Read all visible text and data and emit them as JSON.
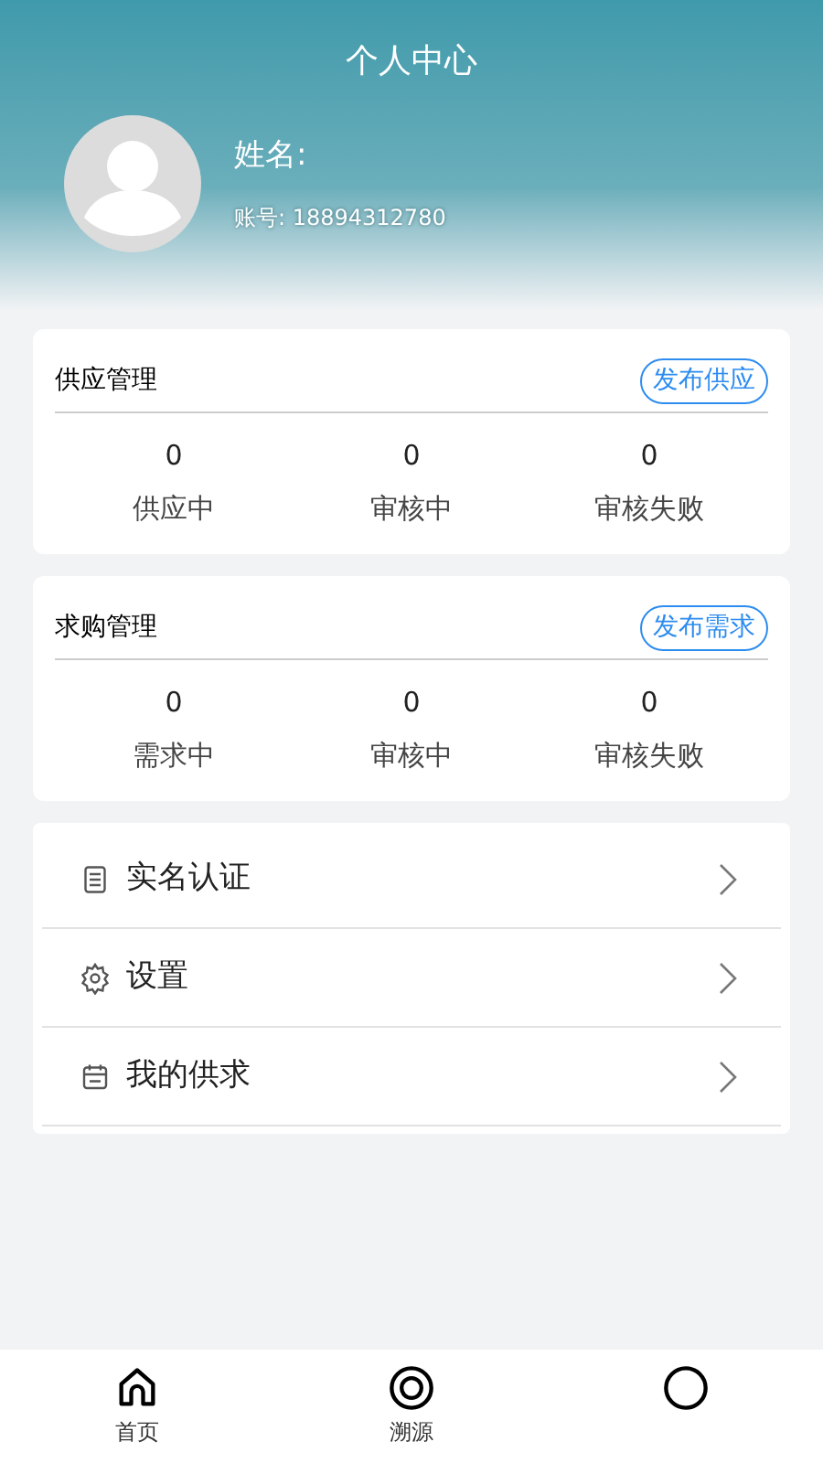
{
  "header": {
    "title": "个人中心",
    "name_label": "姓名:",
    "account": "账号: 18894312780"
  },
  "sections": [
    {
      "title": "供应管理",
      "action": "发布供应",
      "stats": [
        {
          "value": "0",
          "label": "供应中"
        },
        {
          "value": "0",
          "label": "审核中"
        },
        {
          "value": "0",
          "label": "审核失败"
        }
      ]
    },
    {
      "title": "求购管理",
      "action": "发布需求",
      "stats": [
        {
          "value": "0",
          "label": "需求中"
        },
        {
          "value": "0",
          "label": "审核中"
        },
        {
          "value": "0",
          "label": "审核失败"
        }
      ]
    }
  ],
  "menu": [
    {
      "kind": "document",
      "label": "实名认证"
    },
    {
      "kind": "gear",
      "label": "设置"
    },
    {
      "kind": "calendar",
      "label": "我的供求"
    }
  ],
  "tabs": [
    {
      "kind": "home",
      "label": "首页"
    },
    {
      "kind": "trace",
      "label": "溯源"
    },
    {
      "kind": "user"
    }
  ]
}
